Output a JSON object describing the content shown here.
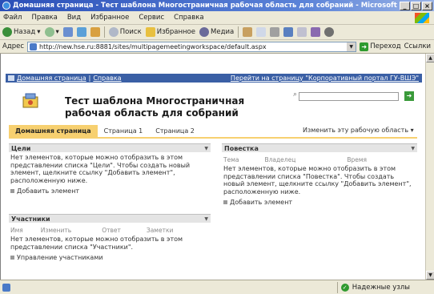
{
  "window": {
    "title": "Домашняя страница - Тест шаблона Многостраничная рабочая область для собраний - Microsoft Internet Expl...",
    "buttons": [
      "_",
      "□",
      "×"
    ]
  },
  "menu": [
    "Файл",
    "Правка",
    "Вид",
    "Избранное",
    "Сервис",
    "Справка"
  ],
  "toolbar": {
    "back": "Назад",
    "search": "Поиск",
    "favorites": "Избранное",
    "media": "Медиа"
  },
  "address": {
    "label": "Адрес",
    "url": "http://new.hse.ru:8881/sites/multipagemeetingworkspace/default.aspx",
    "go": "Переход",
    "links": "Ссылки"
  },
  "sharepoint": {
    "topbar": {
      "home": "Домашняя страница",
      "help": "Справка",
      "portal_link": "Перейти на страницу \"Корпоративный портал ГУ-ВШЭ\""
    },
    "site_title": "Тест шаблона Многостраничная рабочая область для собраний",
    "tabs": [
      "Домашняя страница",
      "Страница 1",
      "Страница 2"
    ],
    "edit_workspace": "Изменить эту рабочую область"
  },
  "webparts": {
    "goals": {
      "title": "Цели",
      "empty": "Нет элементов, которые можно отобразить в этом представлении списка \"Цели\". Чтобы создать новый элемент, щелкните ссылку \"Добавить элемент\", расположенную ниже.",
      "add": "Добавить элемент"
    },
    "agenda": {
      "title": "Повестка",
      "columns": [
        "Тема",
        "Владелец",
        "Время"
      ],
      "empty": "Нет элементов, которые можно отобразить в этом представлении списка \"Повестка\". Чтобы создать новый элемент, щелкните ссылку \"Добавить элемент\", расположенную ниже.",
      "add": "Добавить элемент"
    },
    "attendees": {
      "title": "Участники",
      "columns": [
        "Имя",
        "Изменить",
        "Ответ",
        "Заметки"
      ],
      "empty": "Нет элементов, которые можно отобразить в этом представлении списка \"Участники\".",
      "manage": "Управление участниками"
    }
  },
  "status": {
    "zone": "Надежные узлы"
  }
}
